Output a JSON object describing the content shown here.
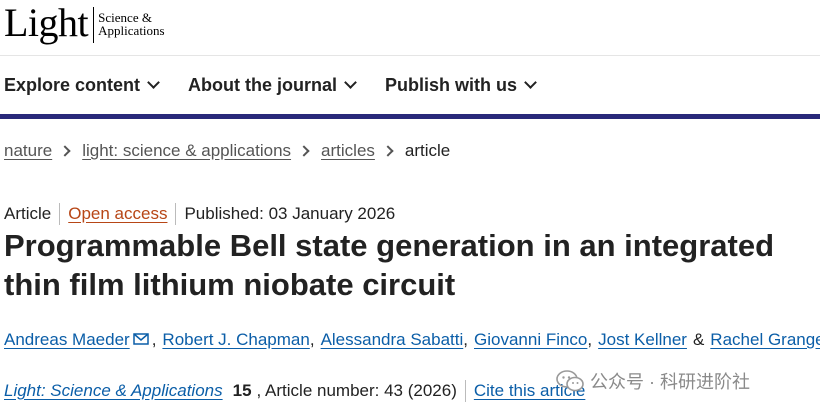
{
  "logo": {
    "main": "Light",
    "sub_line1": "Science &",
    "sub_line2": "Applications"
  },
  "nav": {
    "items": [
      {
        "label": "Explore content"
      },
      {
        "label": "About the journal"
      },
      {
        "label": "Publish with us"
      }
    ]
  },
  "breadcrumb": {
    "items": [
      "nature",
      "light: science & applications",
      "articles"
    ],
    "current": "article"
  },
  "meta": {
    "type": "Article",
    "access": "Open access",
    "published": "Published: 03 January 2026"
  },
  "article": {
    "title": "Programmable Bell state generation in an integrated thin film lithium niobate circuit"
  },
  "authors": {
    "list": [
      "Andreas Maeder",
      "Robert J. Chapman",
      "Alessandra Sabatti",
      "Giovanni Finco",
      "Jost Kellner",
      "Rachel Grange"
    ],
    "amp": "&"
  },
  "citation": {
    "journal": "Light: Science & Applications",
    "volume": "15",
    "article_number": ", Article number: 43 (2026)",
    "cite_link": "Cite this article"
  },
  "watermark": {
    "text": "公众号 · 科研进阶社"
  },
  "colors": {
    "nav_bar": "#29297a",
    "link": "#0b5ea8",
    "open_access": "#b74616"
  }
}
